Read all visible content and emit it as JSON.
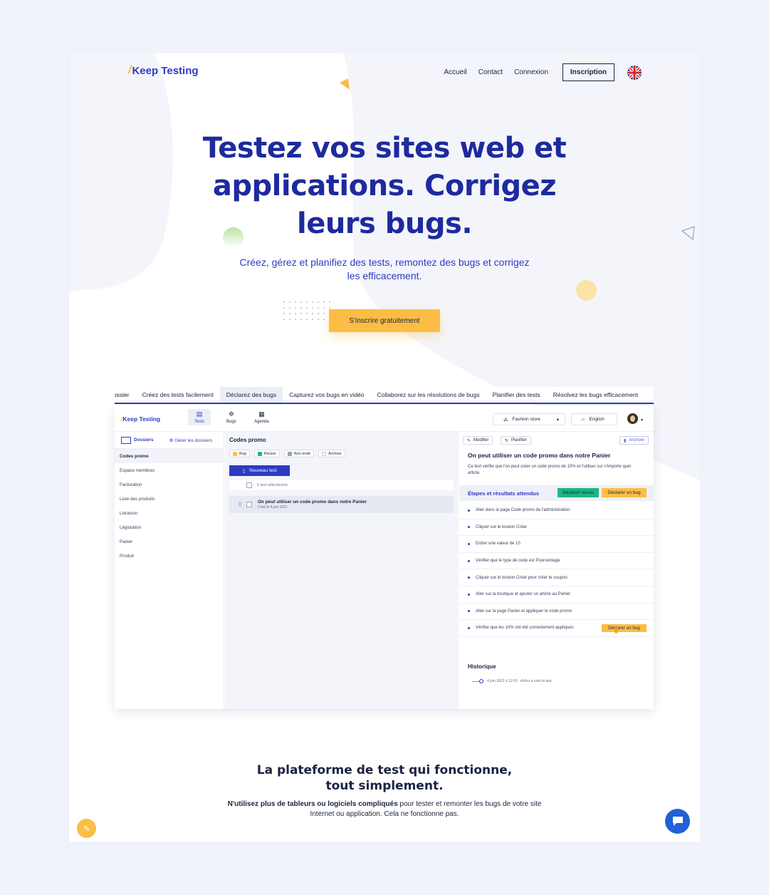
{
  "brand": {
    "name": "Keep Testing",
    "mark_color": "#2e3ac2",
    "accent_color": "#f7b731"
  },
  "nav": {
    "links": [
      "Accueil",
      "Contact",
      "Connexion"
    ],
    "signup": "Inscription",
    "language_flag": "uk-flag-icon"
  },
  "hero": {
    "title": "Testez vos sites web et applications. Corrigez leurs bugs.",
    "subtitle": "Créez, gérez et planifiez des tests, remontez des bugs et corrigez les efficacement.",
    "cta": "S'inscrire gratuitement"
  },
  "feature_tabs": {
    "items": [
      "lossier",
      "Créez des tests facilement",
      "Déclarez des bugs",
      "Capturez vos bugs en vidéo",
      "Collaborez sur les résolutions de bugs",
      "Planifier des tests",
      "Résolvez les bugs efficacement"
    ],
    "active": "Déclarez des bugs"
  },
  "app": {
    "logo": "Keep Testing",
    "nav": {
      "tests": "Tests",
      "bugs": "Bugs",
      "agenda": "Agenda"
    },
    "project": "Fashion store",
    "language": "English",
    "sidebar": {
      "title": "Dossiers",
      "manage": "Gérer les dossiers",
      "items": [
        "Codes promo",
        "Espace membres",
        "Facturation",
        "Liste des produits",
        "Livraison",
        "Législation",
        "Panier",
        "Produit"
      ]
    },
    "middle": {
      "title": "Codes promo",
      "filters": [
        "Bug",
        "Réussi",
        "Non testé",
        "Archivé"
      ],
      "new_test": "Nouveau test",
      "selected": "0 test sélectionné",
      "test_title": "On peut utiliser un code promo dans notre Panier",
      "test_date": "Créé le 4 juin 2021"
    },
    "detail": {
      "edit": "Modifier",
      "plan": "Planifier",
      "archive": "Archiver",
      "title": "On peut utiliser un code promo dans notre Panier",
      "description": "Ce test vérifie que l'on peut créer un code promo de 10% et l'utiliser sur n'importe quel article.",
      "steps_title": "Étapes et résultats attendus",
      "pass_btn": "Déclarer réussi",
      "bug_btn": "Déclarer un bug",
      "steps": [
        "Aller dans la page Code promo de l'administration",
        "Cliquer sur le bouton Créer",
        "Entrer une valeur de 10",
        "Vérifier que le type de code est Pourcentage",
        "Cliquer sur le bouton Créer pour créer le coupon",
        "Aller sur la boutique et ajouter un article au Panier",
        "Aller sur la page Panier et appliquer le code promo",
        "Vérifier que les 10% ont été correctement appliqués"
      ],
      "step_bug_btn": "Déclarer un bug",
      "history_title": "Historique",
      "history_entry": "4 juin 2021 à 12:05 · Arthur a créé le test."
    }
  },
  "section": {
    "title": "La plateforme de test qui fonctionne, tout simplement.",
    "desc_bold": "N'utilisez plus de tableurs ou logiciels compliqués",
    "desc_rest": " pour tester et remonter les bugs de votre site Internet ou application. Cela ne fonctionne pas."
  },
  "colors": {
    "primary": "#2e3ac2",
    "yellow": "#fbbd45",
    "green": "#1db584",
    "chat": "#2160d8"
  }
}
